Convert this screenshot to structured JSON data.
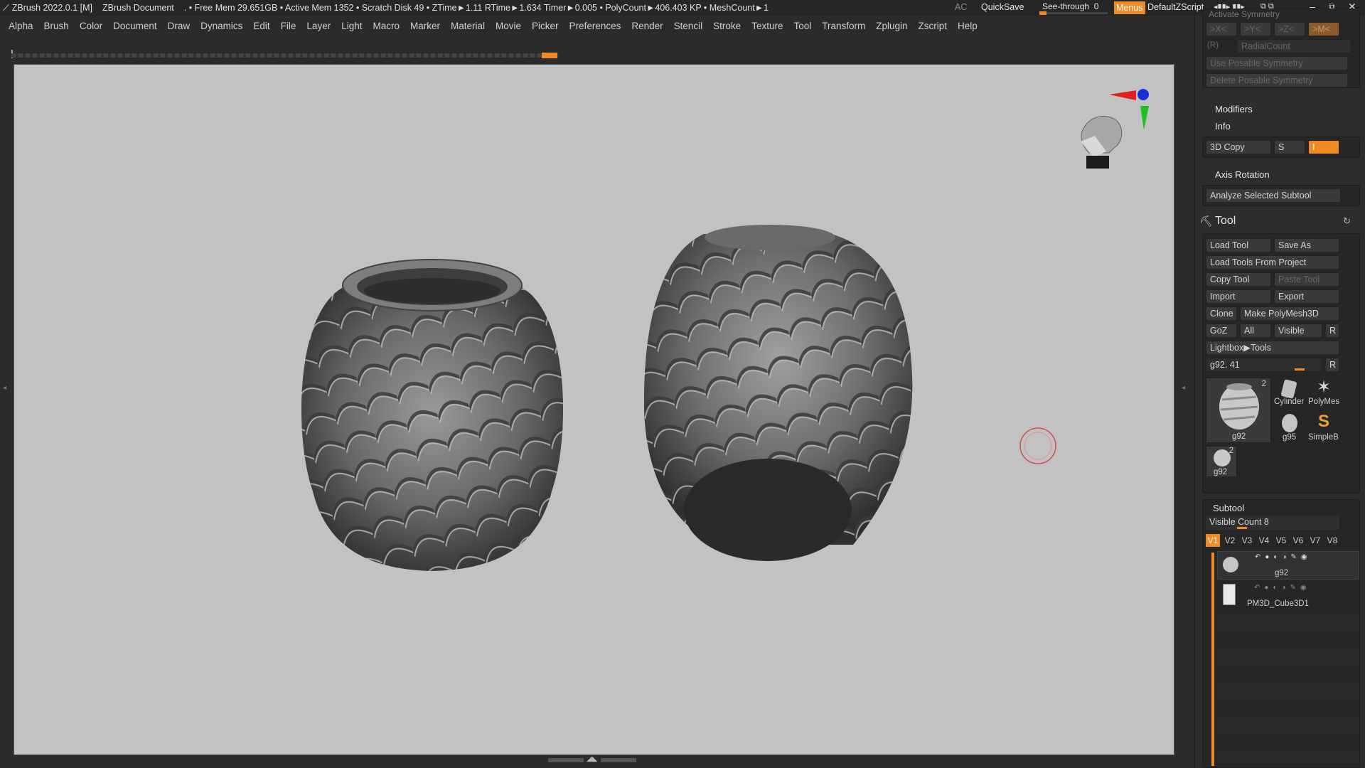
{
  "titlebar": {
    "app": "ZBrush 2022.0.1 [M]",
    "document": "ZBrush Document",
    "stats": ". • Free Mem 29.651GB • Active Mem 1352 • Scratch Disk 49 •  ZTime►1.11 RTime►1.634 Timer►0.005 • PolyCount►406.403 KP  • MeshCount►1",
    "ac": "AC",
    "quicksave": "QuickSave",
    "see_through": "See-through  0",
    "menus": "Menus",
    "script": "DefaultZScript"
  },
  "menus": [
    "Alpha",
    "Brush",
    "Color",
    "Document",
    "Draw",
    "Dynamics",
    "Edit",
    "File",
    "Layer",
    "Light",
    "Macro",
    "Marker",
    "Material",
    "Movie",
    "Picker",
    "Preferences",
    "Render",
    "Stencil",
    "Stroke",
    "Texture",
    "Tool",
    "Transform",
    "Zplugin",
    "Zscript",
    "Help"
  ],
  "symmetry": {
    "partial_title": "Activate Symmetry",
    "x": ">X<",
    "y": ">Y<",
    "z": ">Z<",
    "m": ">M<",
    "r": "(R)",
    "radial": "RadialCount",
    "posable": "Use Posable Symmetry",
    "delete_posable": "Delete Posable Symmetry"
  },
  "geometry_sub": {
    "modifiers": "Modifiers",
    "info": "Info",
    "copy3d": "3D Copy",
    "s": "S",
    "i": "I",
    "axis_rotation": "Axis Rotation",
    "analyze": "Analyze Selected Subtool"
  },
  "tool": {
    "title": "Tool",
    "load_tool": "Load Tool",
    "save_as": "Save As",
    "load_from_project": "Load Tools From Project",
    "copy_tool": "Copy Tool",
    "paste_tool": "Paste Tool",
    "import": "Import",
    "export": "Export",
    "clone": "Clone",
    "make_polymesh": "Make PolyMesh3D",
    "goz": "GoZ",
    "all": "All",
    "visible": "Visible",
    "r": "R",
    "lightbox": "Lightbox▶Tools",
    "current": "g92. 41",
    "current_r": "R",
    "thumbs": [
      {
        "label": "g92",
        "badge": "2"
      },
      {
        "label": "Cylinder"
      },
      {
        "label": "PolyMes"
      },
      {
        "label": "g95"
      },
      {
        "label": "SimpleB"
      },
      {
        "label": "g92",
        "badge": "2"
      }
    ]
  },
  "subtool": {
    "title": "Subtool",
    "visible_count": "Visible Count 8",
    "tabs": [
      "V1",
      "V2",
      "V3",
      "V4",
      "V5",
      "V6",
      "V7",
      "V8"
    ],
    "active_tab": "V1",
    "items": [
      {
        "name": "g92"
      },
      {
        "name": "PM3D_Cube3D1"
      }
    ]
  },
  "colors": {
    "accent": "#f08a24",
    "canvas": "#c2c2c2",
    "panel": "#2d2d2d"
  }
}
